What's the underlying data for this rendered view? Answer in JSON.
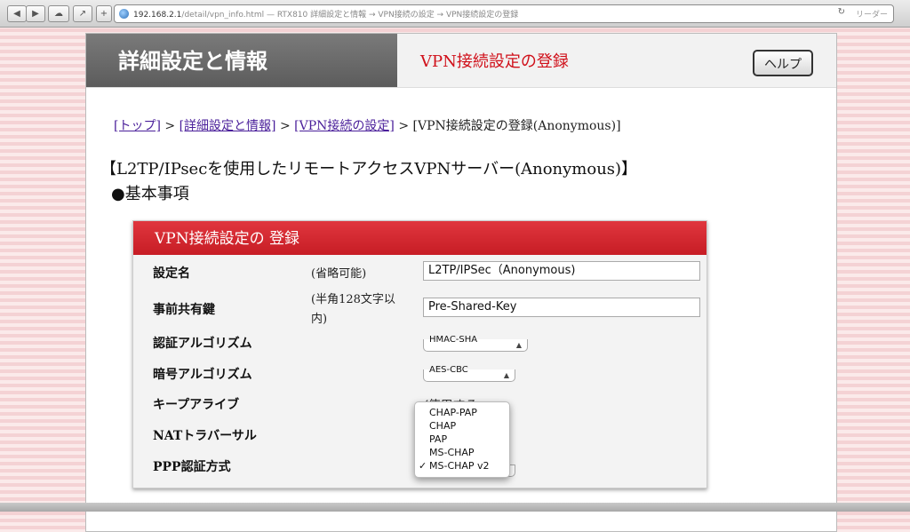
{
  "browser": {
    "url_host": "192.168.2.1",
    "url_path": "/detail/vpn_info.html — RTX810 詳細設定と情報 → VPN接続の設定 → VPN接続設定の登録",
    "reader_label": "リーダー"
  },
  "header": {
    "section": "詳細設定と情報",
    "page_title": "VPN接続設定の登録",
    "help_label": "ヘルプ"
  },
  "breadcrumb": {
    "top": "[トップ]",
    "sep": ">",
    "detail": "[詳細設定と情報]",
    "vpn": "[VPN接続の設定]",
    "current": "[VPN接続設定の登録(Anonymous)]"
  },
  "content": {
    "heading": "【L2TP/IPsecを使用したリモートアクセスVPNサーバー(Anonymous)】",
    "subheading": "●基本事項"
  },
  "form": {
    "panel_title": "VPN接続設定の 登録",
    "fields": {
      "name_label": "設定名",
      "name_note": "(省略可能)",
      "name_value": "L2TP/IPSec（Anonymous)",
      "psk_label": "事前共有鍵",
      "psk_note_1": "(半角128文字以",
      "psk_note_2": "内)",
      "psk_value": "Pre-Shared-Key",
      "auth_label": "認証アルゴリズム",
      "auth_value": "HMAC-SHA",
      "enc_label": "暗号アルゴリズム",
      "enc_value": "AES-CBC",
      "keepalive_label": "キープアライブ",
      "keepalive_value": "✓使用する",
      "nat_label": "NATトラバーサル",
      "ppp_label": "PPP認証方式"
    }
  },
  "dropdown": {
    "options": [
      "CHAP-PAP",
      "CHAP",
      "PAP",
      "MS-CHAP",
      "MS-CHAP v2"
    ],
    "selected": "MS-CHAP v2",
    "check": "✓"
  }
}
